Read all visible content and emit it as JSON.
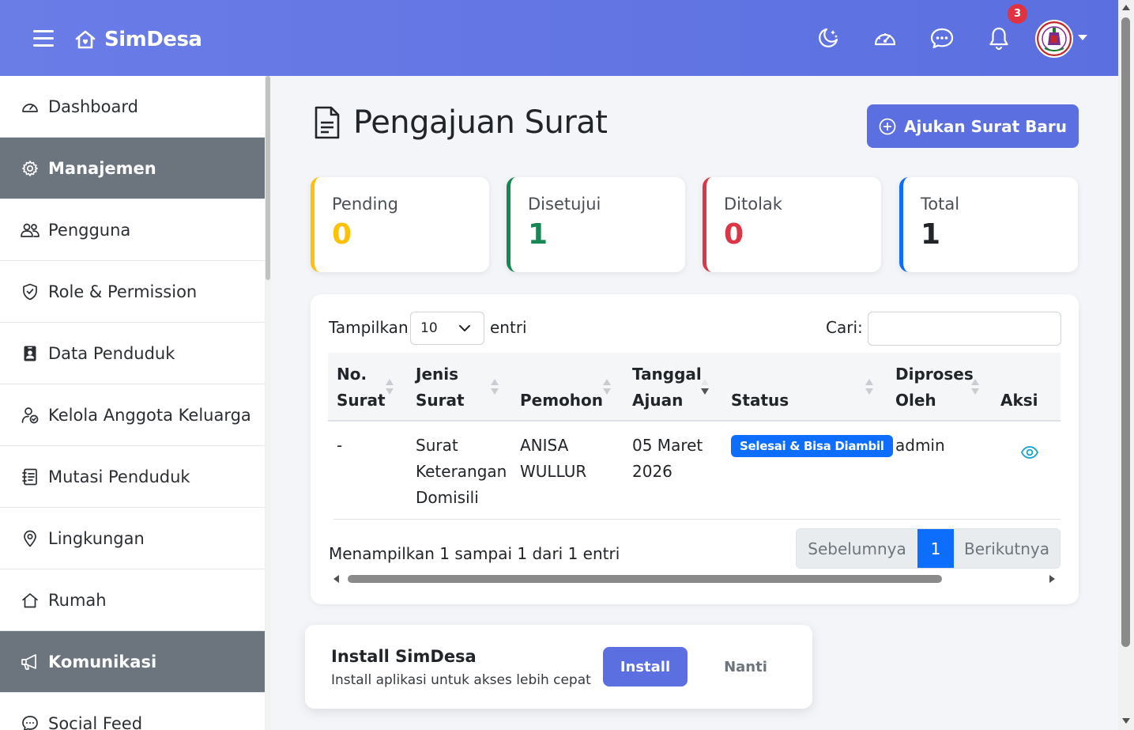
{
  "navbar": {
    "brand": "SimDesa",
    "notification_count": "3",
    "icons": [
      "moon-stars-icon",
      "speedometer-icon",
      "chat-dots-icon",
      "bell-icon"
    ]
  },
  "sidebar": {
    "items": [
      {
        "label": "Dashboard",
        "icon": "speedometer-icon",
        "section": false
      },
      {
        "label": "Manajemen",
        "icon": "gear-icon",
        "section": true
      },
      {
        "label": "Pengguna",
        "icon": "people-icon",
        "section": false
      },
      {
        "label": "Role & Permission",
        "icon": "shield-icon",
        "section": false
      },
      {
        "label": "Data Penduduk",
        "icon": "person-badge-icon",
        "section": false
      },
      {
        "label": "Kelola Anggota Keluarga",
        "icon": "person-check-icon",
        "section": false
      },
      {
        "label": "Mutasi Penduduk",
        "icon": "journal-icon",
        "section": false
      },
      {
        "label": "Lingkungan",
        "icon": "geo-pin-icon",
        "section": false
      },
      {
        "label": "Rumah",
        "icon": "house-icon",
        "section": false
      },
      {
        "label": "Komunikasi",
        "icon": "megaphone-icon",
        "section": true
      },
      {
        "label": "Social Feed",
        "icon": "chat-icon",
        "section": false
      }
    ]
  },
  "page": {
    "title": "Pengajuan Surat",
    "new_button": "Ajukan Surat Baru"
  },
  "stats": [
    {
      "label": "Pending",
      "value": "0",
      "color": "#ffc107"
    },
    {
      "label": "Disetujui",
      "value": "1",
      "color": "#198754"
    },
    {
      "label": "Ditolak",
      "value": "0",
      "color": "#dc3545"
    },
    {
      "label": "Total",
      "value": "1",
      "color": "#0d6efd"
    }
  ],
  "table": {
    "show_label": "Tampilkan",
    "page_size": "10",
    "entries_label": "entri",
    "search_label": "Cari:",
    "search_value": "",
    "columns": [
      {
        "line1": "No.",
        "line2": "Surat"
      },
      {
        "line1": "Jenis",
        "line2": "Surat"
      },
      {
        "line1": "",
        "line2": "Pemohon"
      },
      {
        "line1": "Tanggal",
        "line2": "Ajuan"
      },
      {
        "line1": "",
        "line2": "Status"
      },
      {
        "line1": "Diproses",
        "line2": "Oleh"
      },
      {
        "line1": "",
        "line2": "Aksi"
      }
    ],
    "rows": [
      {
        "no": "-",
        "jenis": [
          "Surat",
          "Keterangan",
          "Domisili"
        ],
        "pemohon": [
          "ANISA",
          "WULLUR"
        ],
        "tanggal": [
          "05 Maret",
          "2026"
        ],
        "status": "Selesai & Bisa Diambil",
        "status_color": "#0d6efd",
        "diproses": "admin",
        "aksi_icon": "eye-icon"
      }
    ],
    "info": "Menampilkan 1 sampai 1 dari 1 entri",
    "pager": {
      "prev": "Sebelumnya",
      "current": "1",
      "next": "Berikutnya"
    }
  },
  "install": {
    "title": "Install SimDesa",
    "subtitle": "Install aplikasi untuk akses lebih cepat",
    "install_button": "Install",
    "later_button": "Nanti"
  }
}
